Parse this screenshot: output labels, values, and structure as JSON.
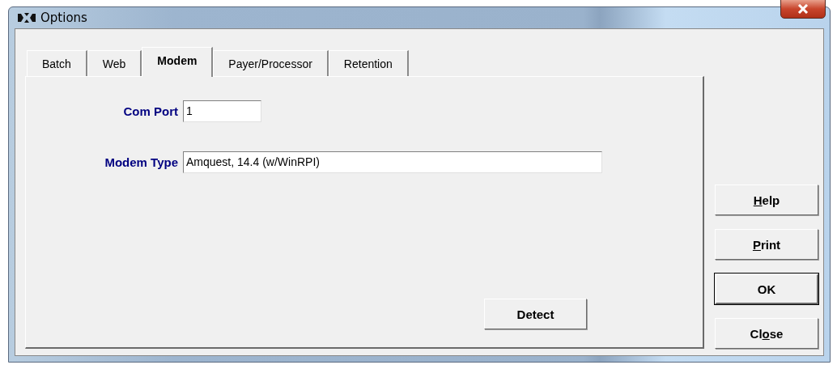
{
  "window": {
    "title": "Options"
  },
  "tabs": [
    {
      "label": "Batch",
      "selected": false
    },
    {
      "label": "Web",
      "selected": false
    },
    {
      "label": "Modem",
      "selected": true
    },
    {
      "label": "Payer/Processor",
      "selected": false
    },
    {
      "label": "Retention",
      "selected": false
    }
  ],
  "fields": [
    {
      "label": "Com Port",
      "value": "1",
      "kind": "short"
    },
    {
      "label": "Modem Type",
      "value": "Amquest, 14.4 (w/WinRPI)",
      "kind": "long"
    }
  ],
  "detect_button": "Detect",
  "buttons": [
    {
      "key": "H",
      "after": "elp",
      "default": false
    },
    {
      "key": "P",
      "after": "rint",
      "default": false
    },
    {
      "label": "OK",
      "default": true
    },
    {
      "before": "Cl",
      "key": "o",
      "after": "se",
      "default": false
    }
  ]
}
